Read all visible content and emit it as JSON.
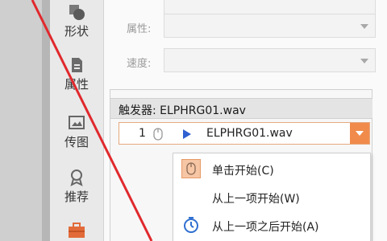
{
  "sidebar": {
    "items": [
      {
        "label": "形状",
        "icon": "shapes-icon"
      },
      {
        "label": "属性",
        "icon": "properties-icon"
      },
      {
        "label": "传图",
        "icon": "upload-image-icon"
      },
      {
        "label": "推荐",
        "icon": "recommend-icon"
      },
      {
        "label": "",
        "icon": "toolbox-icon"
      }
    ]
  },
  "form": {
    "property_label": "属性:",
    "speed_label": "速度:"
  },
  "trigger": {
    "title": "触发器: ELPHRG01.wav",
    "combo": {
      "number": "1",
      "name": "ELPHRG01.wav"
    }
  },
  "menu": {
    "items": [
      {
        "label": "单击开始(C)",
        "icon": "mouse-click-icon"
      },
      {
        "label": "从上一项开始(W)",
        "icon": ""
      },
      {
        "label": "从上一项之后开始(A)",
        "icon": "clock-icon"
      }
    ]
  },
  "colors": {
    "accent": "#f08b4c",
    "annotation": "#e0292d",
    "play": "#2f5fd0"
  }
}
